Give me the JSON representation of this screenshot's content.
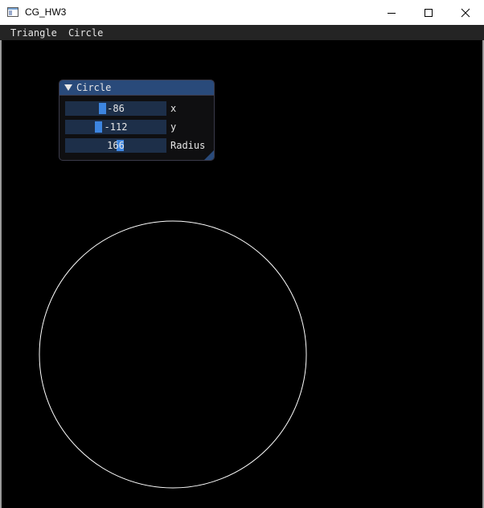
{
  "window": {
    "title": "CG_HW3"
  },
  "menubar": {
    "items": [
      {
        "label": "Triangle"
      },
      {
        "label": "Circle"
      }
    ]
  },
  "panel": {
    "title": "Circle",
    "sliders": [
      {
        "label": "x",
        "value": "-86"
      },
      {
        "label": "y",
        "value": "-112"
      },
      {
        "label": "Radius",
        "value": "166"
      }
    ]
  },
  "colors": {
    "menubar": "#242424",
    "panel_title": "#294a7a",
    "slider_frame": "#1d2f49",
    "slider_grab": "#3d85e0",
    "circle_stroke": "#ffffff"
  }
}
